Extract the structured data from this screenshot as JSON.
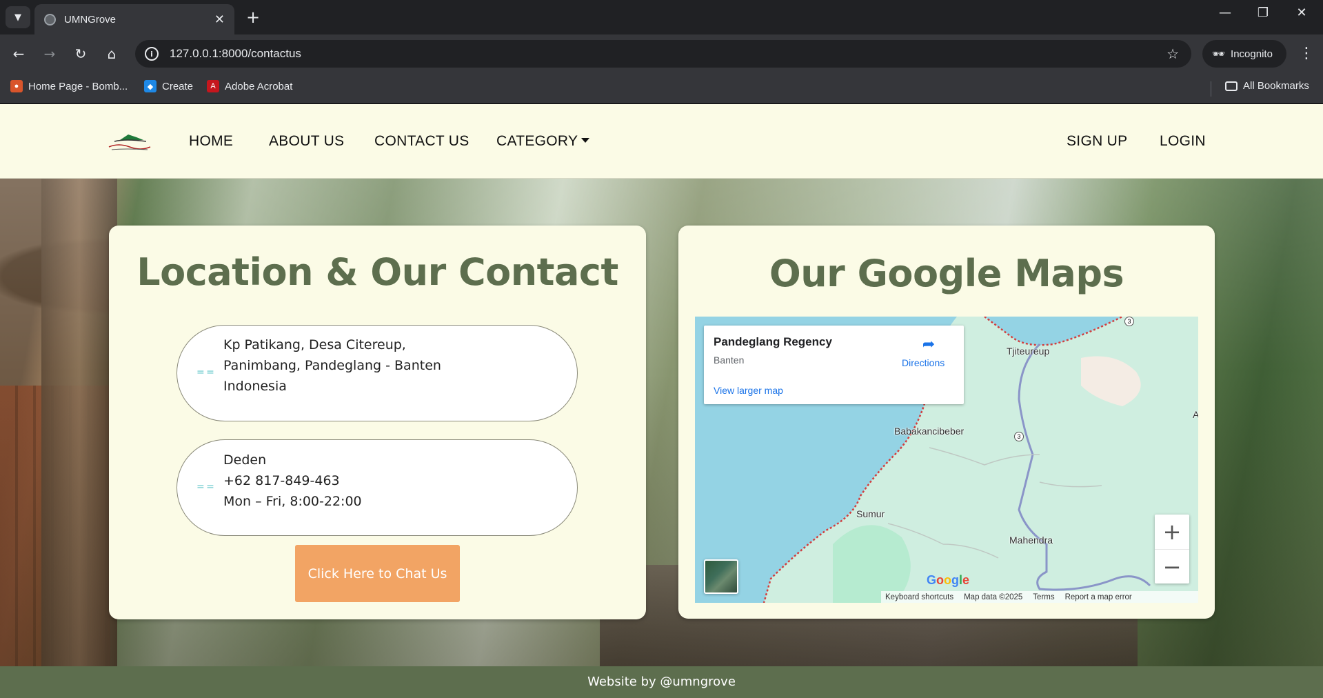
{
  "browser": {
    "tab_title": "UMNGrove",
    "url": "127.0.0.1:8000/contactus",
    "incognito_label": "Incognito",
    "bookmarks": [
      {
        "label": "Home Page - Bomb..."
      },
      {
        "label": "Create"
      },
      {
        "label": "Adobe Acrobat"
      }
    ],
    "all_bookmarks_label": "All Bookmarks"
  },
  "nav": {
    "home": "HOME",
    "about": "ABOUT US",
    "contact": "CONTACT US",
    "category": "CATEGORY",
    "signup": "SIGN UP",
    "login": "LOGIN"
  },
  "contact_card": {
    "title": "Location & Our Contact",
    "address_lines": [
      "Kp Patikang, Desa Citereup,",
      "Panimbang, Pandeglang - Banten",
      "Indonesia"
    ],
    "contact_lines": [
      "Deden",
      "+62 817-849-463",
      "Mon – Fri, 8:00-22:00"
    ],
    "chat_button": "Click Here to Chat Us"
  },
  "map_card": {
    "title": "Our Google Maps",
    "place_name": "Pandeglang Regency",
    "place_region": "Banten",
    "directions_label": "Directions",
    "view_larger_label": "View larger map",
    "labels": {
      "tjiteureup": "Tjiteureup",
      "babakancibeber": "Babakancibeber",
      "sumur": "Sumur",
      "mahendra": "Mahendra",
      "edge": "A"
    },
    "route_number": "3",
    "footer_links": [
      "Keyboard shortcuts",
      "Map data ©2025",
      "Terms",
      "Report a map error"
    ],
    "zoom_in": "+",
    "zoom_out": "−"
  },
  "footer": {
    "text": "Website by @umngrove"
  },
  "colors": {
    "accent_green": "#5d6e4e",
    "cream": "#fbfbe6",
    "button_orange": "#f2a464",
    "link_blue": "#1a73e8"
  }
}
